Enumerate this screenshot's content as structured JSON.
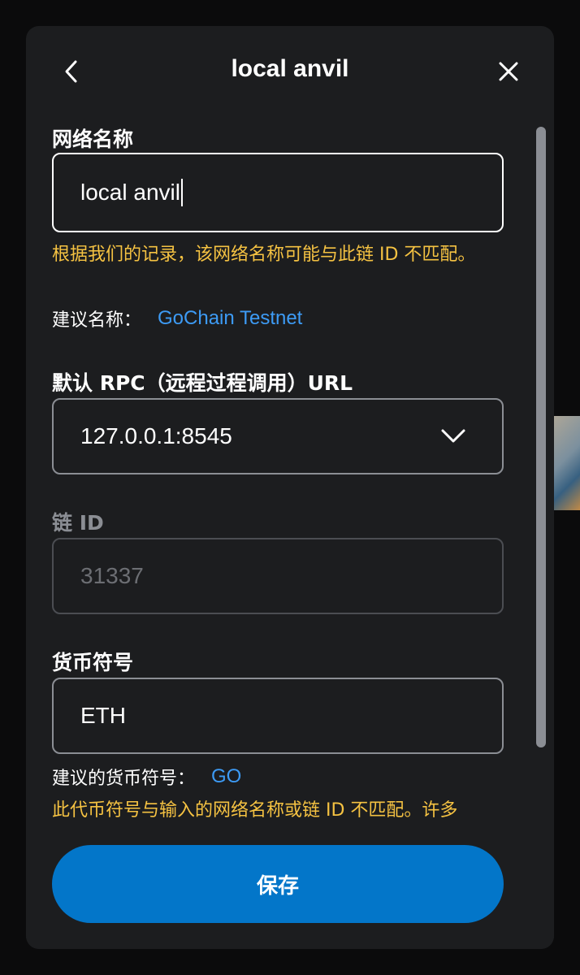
{
  "header": {
    "title": "local anvil",
    "back_icon": "chevron-left-icon",
    "close_icon": "close-icon"
  },
  "network_name": {
    "label": "网络名称",
    "value": "local anvil",
    "warning": "根据我们的记录，该网络名称可能与此链 ID 不匹配。",
    "suggestion_label": "建议名称：",
    "suggestion_value": "GoChain Testnet"
  },
  "rpc": {
    "label": "默认 RPC（远程过程调用）URL",
    "value": "127.0.0.1:8545",
    "dropdown_icon": "chevron-down-icon"
  },
  "chain_id": {
    "label": "链 ID",
    "value": "31337"
  },
  "currency": {
    "label": "货币符号",
    "value": "ETH",
    "suggestion_label": "建议的货币符号：",
    "suggestion_value": "GO",
    "warning": "此代币符号与输入的网络名称或链 ID 不匹配。许多"
  },
  "footer": {
    "save_label": "保存"
  },
  "colors": {
    "accent": "#0376c9",
    "warning": "#f5c242",
    "link": "#3d9bf5"
  }
}
